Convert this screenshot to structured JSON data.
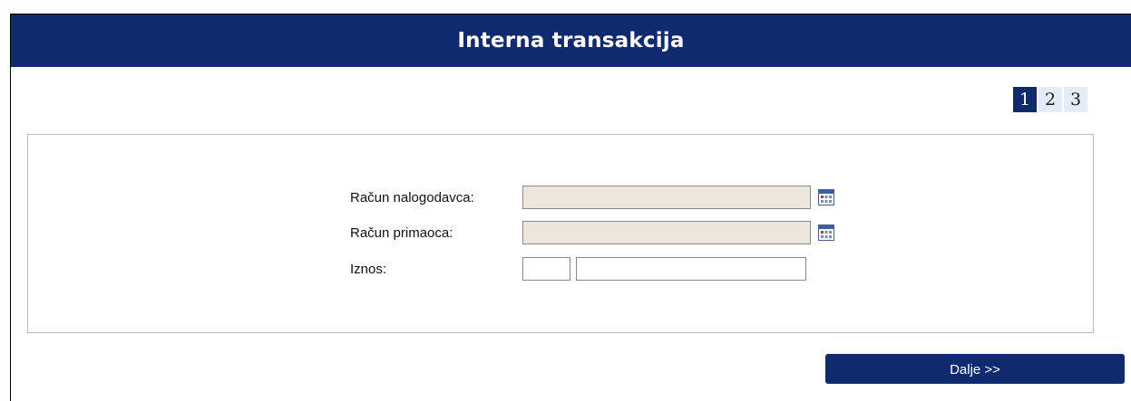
{
  "header": {
    "title": "Interna transakcija"
  },
  "steps": {
    "items": [
      "1",
      "2",
      "3"
    ],
    "active": "1"
  },
  "form": {
    "payer_account": {
      "label": "Račun nalogodavca:",
      "value": "",
      "picker_icon": "account-picker-icon"
    },
    "recipient_account": {
      "label": "Račun primaoca:",
      "value": "",
      "picker_icon": "account-picker-icon"
    },
    "amount": {
      "label": "Iznos:",
      "currency_value": "",
      "amount_value": ""
    }
  },
  "actions": {
    "next_label": "Dalje >>"
  },
  "colors": {
    "header_bg": "#0f2a6e",
    "step_active_bg": "#0f2a6e",
    "step_bg": "#e4ecf7",
    "readonly_field_bg": "#ece7da"
  }
}
